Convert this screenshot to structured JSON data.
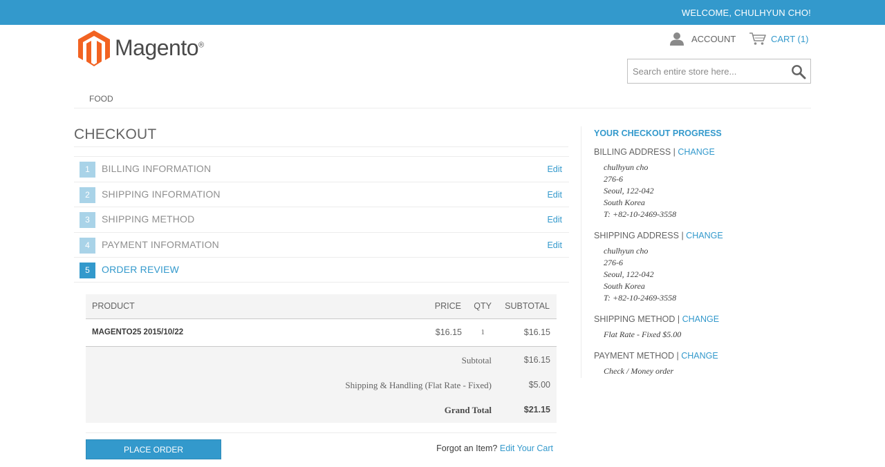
{
  "header": {
    "welcome": "WELCOME, CHULHYUN CHO!",
    "logo_text": "Magento",
    "logo_mark": "®",
    "account_label": "ACCOUNT",
    "cart_label": "CART (1)",
    "search_placeholder": "Search entire store here...",
    "icons": {
      "account": "user-icon",
      "cart": "cart-icon",
      "search": "search-icon"
    },
    "colors": {
      "accent": "#3399cc",
      "logo_orange": "#f26322"
    }
  },
  "nav": {
    "items": [
      "FOOD"
    ]
  },
  "checkout": {
    "title": "CHECKOUT",
    "steps": [
      {
        "num": "1",
        "label": "BILLING INFORMATION",
        "edit": "Edit"
      },
      {
        "num": "2",
        "label": "SHIPPING INFORMATION",
        "edit": "Edit"
      },
      {
        "num": "3",
        "label": "SHIPPING METHOD",
        "edit": "Edit"
      },
      {
        "num": "4",
        "label": "PAYMENT INFORMATION",
        "edit": "Edit"
      },
      {
        "num": "5",
        "label": "ORDER REVIEW",
        "active": true
      }
    ]
  },
  "review": {
    "headers": {
      "product": "PRODUCT",
      "price": "PRICE",
      "qty": "QTY",
      "subtotal": "SUBTOTAL"
    },
    "items": [
      {
        "product": "MAGENTO25 2015/10/22",
        "price": "$16.15",
        "qty": "1",
        "subtotal": "$16.15"
      }
    ],
    "totals": {
      "subtotal_label": "Subtotal",
      "subtotal_value": "$16.15",
      "shipping_label": "Shipping & Handling (Flat Rate - Fixed)",
      "shipping_value": "$5.00",
      "grand_label": "Grand Total",
      "grand_value": "$21.15"
    },
    "place_order": "PLACE ORDER",
    "forgot_text": "Forgot an Item?",
    "edit_cart": "Edit Your Cart"
  },
  "progress": {
    "title": "YOUR CHECKOUT PROGRESS",
    "separator": "|",
    "change": "CHANGE",
    "billing": {
      "title": "BILLING ADDRESS",
      "lines": [
        "chulhyun cho",
        "276-6",
        "Seoul, 122-042",
        "South Korea",
        "T: +82-10-2469-3558"
      ]
    },
    "shipping": {
      "title": "SHIPPING ADDRESS",
      "lines": [
        "chulhyun cho",
        "276-6",
        "Seoul, 122-042",
        "South Korea",
        "T: +82-10-2469-3558"
      ]
    },
    "shipping_method": {
      "title": "SHIPPING METHOD",
      "value": "Flat Rate - Fixed $5.00"
    },
    "payment_method": {
      "title": "PAYMENT METHOD",
      "value": "Check / Money order"
    }
  }
}
